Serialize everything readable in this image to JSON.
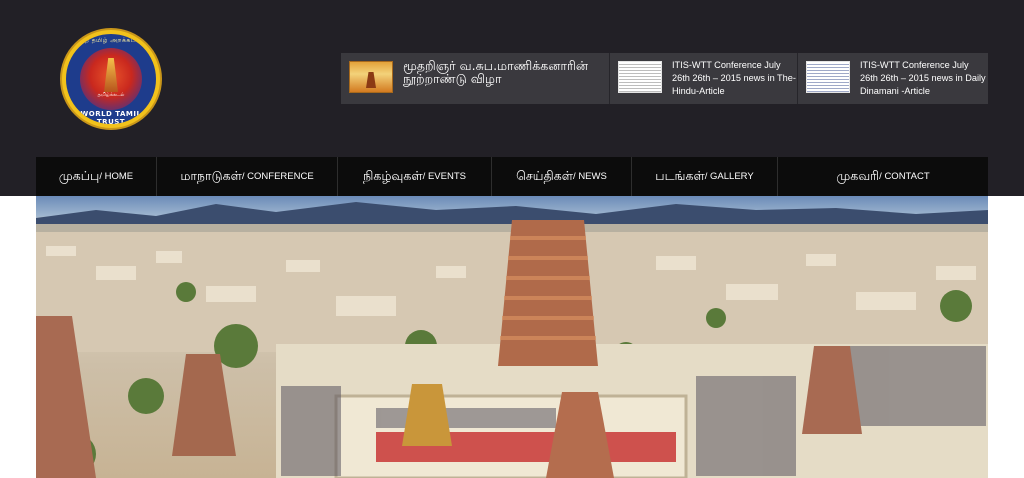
{
  "logo": {
    "top_text": "உலகத் தமிழ் அறக்கட்டளை",
    "bottom_text": "WORLD TAMIL TRUST",
    "inner_caption": "தமிழ்க்கடல்"
  },
  "news": [
    {
      "text": "மூதறிஞர் வ.சுப.மாணிக்கனாரின் நூற்றாண்டு விழா",
      "thumb": "temple-event-thumbnail"
    },
    {
      "text": "ITIS-WTT Conference July 26th 26th – 2015 news in The-Hindu-Article",
      "thumb": "newspaper-thumbnail"
    },
    {
      "text": "ITIS-WTT Conference July 26th 26th – 2015 news in Daily Dinamani -Article",
      "thumb": "newspaper-thumbnail"
    }
  ],
  "nav": [
    {
      "ta": "முகப்பு",
      "en": " / HOME"
    },
    {
      "ta": "மாநாடுகள்",
      "en": " / CONFERENCE"
    },
    {
      "ta": "நிகழ்வுகள்",
      "en": " / EVENTS"
    },
    {
      "ta": "செய்திகள்",
      "en": " / NEWS"
    },
    {
      "ta": "படங்கள்",
      "en": " / GALLERY"
    },
    {
      "ta": "முகவரி",
      "en": " / CONTACT"
    }
  ],
  "colors": {
    "header_bg": "#222026",
    "news_bg": "#3a393e",
    "nav_bg": "#0c0c0c",
    "logo_gold": "#f2c21b",
    "logo_blue": "#1e3c8c"
  },
  "hero": {
    "image": "aerial-temple-city-photo"
  }
}
